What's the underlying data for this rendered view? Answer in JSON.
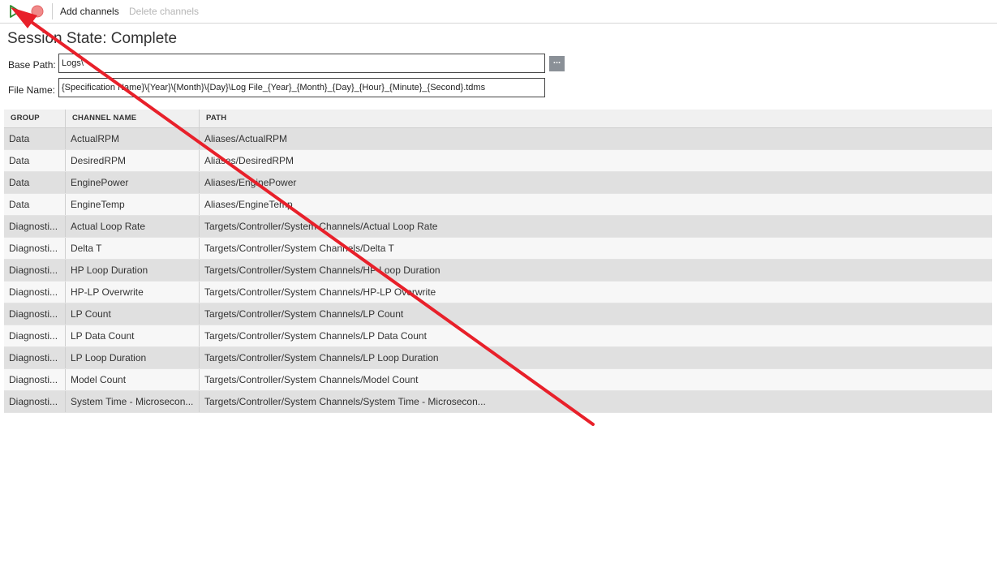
{
  "toolbar": {
    "run_icon": "play-icon",
    "stop_icon": "record-stop-icon",
    "add_label": "Add channels",
    "delete_label": "Delete channels"
  },
  "session": {
    "title": "Session State: Complete"
  },
  "form": {
    "base_path_label": "Base Path:",
    "base_path_value": "Logs\\",
    "browse_label": "...",
    "file_name_label": "File Name:",
    "file_name_value": "{Specification Name}\\{Year}\\{Month}\\{Day}\\Log File_{Year}_{Month}_{Day}_{Hour}_{Minute}_{Second}.tdms"
  },
  "table": {
    "headers": [
      "GROUP",
      "CHANNEL NAME",
      "PATH"
    ],
    "rows": [
      {
        "group": "Data",
        "channel": "ActualRPM",
        "path": "Aliases/ActualRPM"
      },
      {
        "group": "Data",
        "channel": "DesiredRPM",
        "path": "Aliases/DesiredRPM"
      },
      {
        "group": "Data",
        "channel": "EnginePower",
        "path": "Aliases/EnginePower"
      },
      {
        "group": "Data",
        "channel": "EngineTemp",
        "path": "Aliases/EngineTemp"
      },
      {
        "group": "Diagnosti...",
        "channel": "Actual Loop Rate",
        "path": "Targets/Controller/System Channels/Actual Loop Rate"
      },
      {
        "group": "Diagnosti...",
        "channel": "Delta T",
        "path": "Targets/Controller/System Channels/Delta T"
      },
      {
        "group": "Diagnosti...",
        "channel": "HP Loop Duration",
        "path": "Targets/Controller/System Channels/HP Loop Duration"
      },
      {
        "group": "Diagnosti...",
        "channel": "HP-LP Overwrite",
        "path": "Targets/Controller/System Channels/HP-LP Overwrite"
      },
      {
        "group": "Diagnosti...",
        "channel": "LP Count",
        "path": "Targets/Controller/System Channels/LP Count"
      },
      {
        "group": "Diagnosti...",
        "channel": "LP Data Count",
        "path": "Targets/Controller/System Channels/LP Data Count"
      },
      {
        "group": "Diagnosti...",
        "channel": "LP Loop Duration",
        "path": "Targets/Controller/System Channels/LP Loop Duration"
      },
      {
        "group": "Diagnosti...",
        "channel": "Model Count",
        "path": "Targets/Controller/System Channels/Model Count"
      },
      {
        "group": "Diagnosti...",
        "channel": "System Time - Microsecon...",
        "path": "Targets/Controller/System Channels/System Time - Microsecon..."
      }
    ]
  },
  "annotation": {
    "arrow_color": "#e8202a"
  }
}
